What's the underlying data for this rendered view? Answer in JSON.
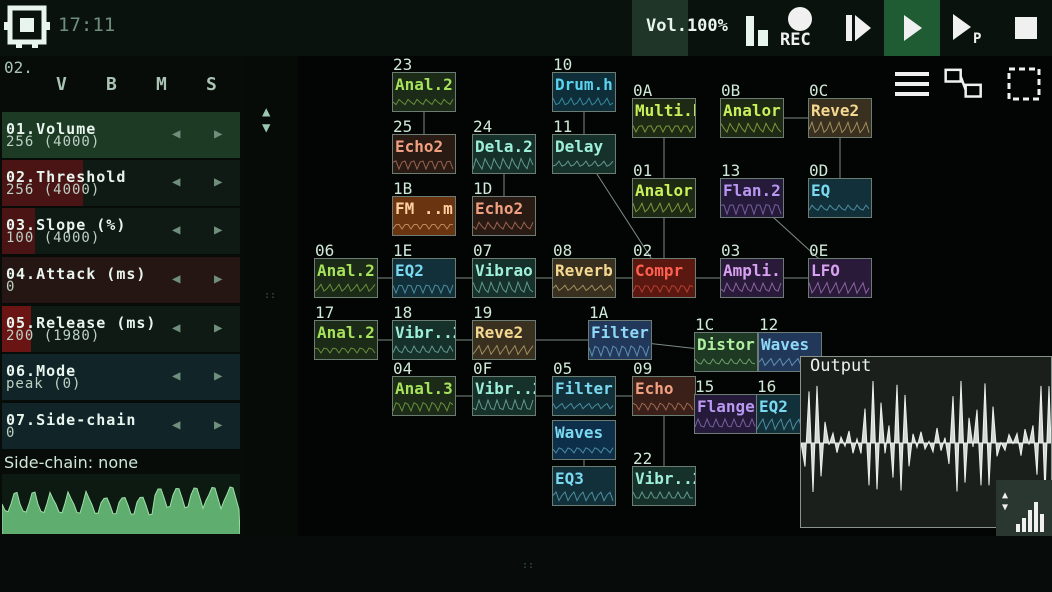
{
  "topbar": {
    "clock": "17:11",
    "volume_label": "Vol.100%",
    "rec_label": "REC",
    "colors": {
      "play_bg": "#1f5c34",
      "vol_bg": "#1f3527"
    }
  },
  "icons": {
    "logo": "sunvox-logo-icon",
    "levels": "levels-icon",
    "record": "record-icon",
    "play_from_start": "play-from-start-icon",
    "play": "play-icon",
    "play_pattern": "play-pattern-icon",
    "stop": "stop-icon",
    "menu": "menu-icon",
    "modules": "modules-icon",
    "select": "select-icon",
    "meter": "meter-icon"
  },
  "left": {
    "channel_id": "02.",
    "columns": [
      "V",
      "B",
      "M",
      "S"
    ],
    "params": [
      {
        "name": "01.Volume",
        "value": "256 (4000)",
        "color": "#1d3a25",
        "fill": 1.0
      },
      {
        "name": "02.Threshold",
        "value": "256 (4000)",
        "color": "#4a1414",
        "fill": 0.34
      },
      {
        "name": "03.Slope (%)",
        "value": "100 (4000)",
        "color": "#4a1414",
        "fill": 0.14
      },
      {
        "name": "04.Attack (ms)",
        "value": "0",
        "color": "#3a1414",
        "fill": 0.0
      },
      {
        "name": "05.Release (ms)",
        "value": "200 (1980)",
        "color": "#6a1414",
        "fill": 0.12
      },
      {
        "name": "06.Mode",
        "value": "peak (0)",
        "color": "#14303a",
        "fill": 0.0
      },
      {
        "name": "07.Side-chain",
        "value": "0",
        "color": "#14303a",
        "fill": 0.0
      }
    ],
    "sidechain_label": "Side-chain: none"
  },
  "graph": {
    "nodes": [
      {
        "id": "23",
        "name": "Anal.2",
        "color": "#a6e25a",
        "bg": "#1c2a18"
      },
      {
        "id": "10",
        "name": "Drum.h",
        "color": "#5ad2f0",
        "bg": "#0e2f3a"
      },
      {
        "id": "25",
        "name": "Echo2",
        "color": "#f0a080",
        "bg": "#2a1a14"
      },
      {
        "id": "24",
        "name": "Dela.2",
        "color": "#9ef0d8",
        "bg": "#16302a"
      },
      {
        "id": "11",
        "name": "Delay",
        "color": "#9ef0d8",
        "bg": "#16302a"
      },
      {
        "id": "0A",
        "name": "Multi.h",
        "color": "#c8f05a",
        "bg": "#1e2a14"
      },
      {
        "id": "0B",
        "name": "Analor",
        "color": "#c8f05a",
        "bg": "#1e2a14"
      },
      {
        "id": "0C",
        "name": "Reve2",
        "color": "#f5d890",
        "bg": "#3a3020"
      },
      {
        "id": "1B",
        "name": "FM ..m",
        "color": "#ffd0a0",
        "bg": "#6a3410"
      },
      {
        "id": "1D",
        "name": "Echo2",
        "color": "#f0a080",
        "bg": "#2a1a14"
      },
      {
        "id": "01",
        "name": "Analor",
        "color": "#c8f05a",
        "bg": "#1e2a14"
      },
      {
        "id": "13",
        "name": "Flan.2",
        "color": "#b898f0",
        "bg": "#251a3a"
      },
      {
        "id": "0D",
        "name": "EQ",
        "color": "#7ad8f0",
        "bg": "#12303a"
      },
      {
        "id": "06",
        "name": "Anal.2",
        "color": "#a6e25a",
        "bg": "#1c2a18"
      },
      {
        "id": "1E",
        "name": "EQ2",
        "color": "#7ad8f0",
        "bg": "#12303a"
      },
      {
        "id": "07",
        "name": "Vibrao",
        "color": "#9ef0d8",
        "bg": "#16302a"
      },
      {
        "id": "08",
        "name": "Reverb",
        "color": "#f5d890",
        "bg": "#3a3020"
      },
      {
        "id": "02",
        "name": "Compr",
        "color": "#ff6050",
        "bg": "#5a1810"
      },
      {
        "id": "03",
        "name": "Ampli.r",
        "color": "#d8a0f0",
        "bg": "#2a1a3a"
      },
      {
        "id": "0E",
        "name": "LFO",
        "color": "#d8a0f0",
        "bg": "#2a1a3a"
      },
      {
        "id": "17",
        "name": "Anal.2",
        "color": "#a6e25a",
        "bg": "#1c2a18"
      },
      {
        "id": "18",
        "name": "Vibr..2",
        "color": "#9ef0d8",
        "bg": "#16302a"
      },
      {
        "id": "19",
        "name": "Reve2",
        "color": "#f5d890",
        "bg": "#3a3020"
      },
      {
        "id": "1A",
        "name": "Filter",
        "color": "#8fd8f8",
        "bg": "#22385a"
      },
      {
        "id": "1C",
        "name": "Distor",
        "color": "#b0f0a0",
        "bg": "#1e3a24"
      },
      {
        "id": "12",
        "name": "Waves",
        "color": "#8fd8f8",
        "bg": "#22385a"
      },
      {
        "id": "04",
        "name": "Anal.3",
        "color": "#a6e25a",
        "bg": "#1c2a18"
      },
      {
        "id": "0F",
        "name": "Vibr..2",
        "color": "#9ef0d8",
        "bg": "#16302a"
      },
      {
        "id": "05",
        "name": "Filter",
        "color": "#7ad8f0",
        "bg": "#12303a"
      },
      {
        "id": "09",
        "name": "Echo",
        "color": "#f0a080",
        "bg": "#3a2018"
      },
      {
        "id": "15",
        "name": "Flanger",
        "color": "#b898f0",
        "bg": "#251a3a"
      },
      {
        "id": "16",
        "name": "EQ2",
        "color": "#7ad8f0",
        "bg": "#12303a"
      },
      {
        "id": "",
        "name": "Waves",
        "color": "#7ad8f0",
        "bg": "#0e2f4a"
      },
      {
        "id": "22",
        "name": "Vibr..2",
        "color": "#9ef0d8",
        "bg": "#16302a"
      },
      {
        "id": "",
        "name": "EQ3",
        "color": "#7ad8f0",
        "bg": "#12303a"
      }
    ],
    "output_label": "Output"
  }
}
